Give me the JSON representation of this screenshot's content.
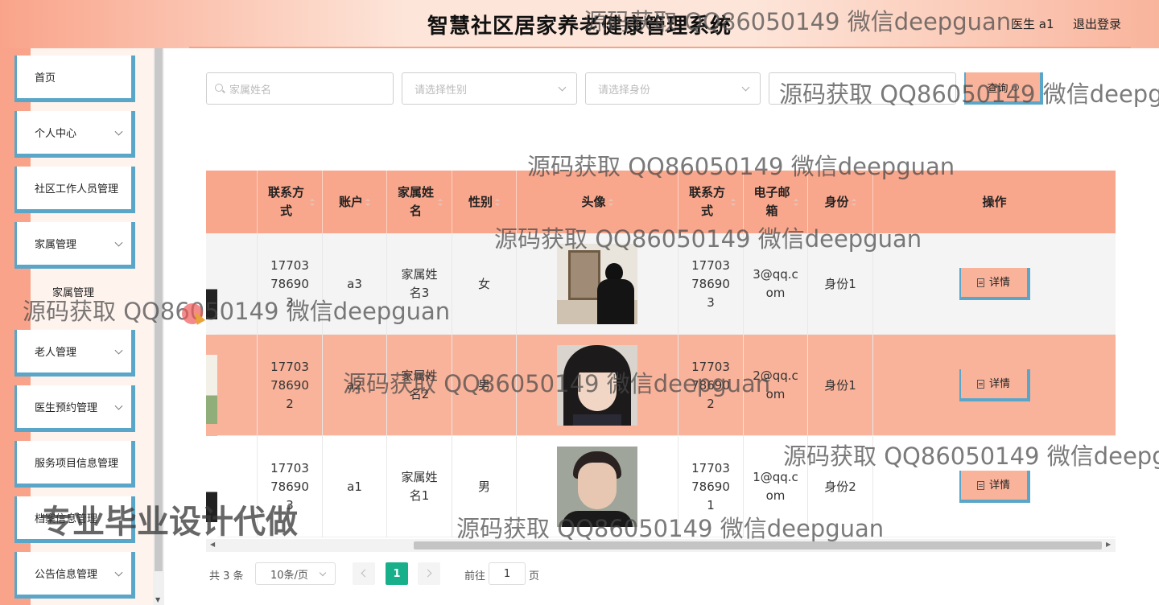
{
  "header": {
    "title": "智慧社区居家养老健康管理系统",
    "user": "医生 a1",
    "logout": "退出登录"
  },
  "sidebar": {
    "items": [
      {
        "label": "首页",
        "has_children": false
      },
      {
        "label": "个人中心",
        "has_children": true
      },
      {
        "label": "社区工作人员管理",
        "has_children": false
      },
      {
        "label": "家属管理",
        "has_children": true
      },
      {
        "label": "老人管理",
        "has_children": true
      },
      {
        "label": "医生预约管理",
        "has_children": true
      },
      {
        "label": "服务项目信息管理",
        "has_children": false
      },
      {
        "label": "档案信息管理",
        "has_children": false
      },
      {
        "label": "公告信息管理",
        "has_children": true
      }
    ],
    "sub_item": "家属管理"
  },
  "search": {
    "name_placeholder": "家属姓名",
    "gender_placeholder": "请选择性别",
    "identity_placeholder": "请选择身份",
    "query_label": "查询"
  },
  "table": {
    "columns": [
      "联系方式",
      "账户",
      "家属姓名",
      "性别",
      "头像",
      "联系方式",
      "电子邮箱",
      "身份",
      "操作"
    ],
    "rows": [
      {
        "phone": "17703786903",
        "account": "a3",
        "name": "家属姓名3",
        "gender": "女",
        "phone2": "17703786903",
        "email": "3@qq.com",
        "identity": "身份1",
        "action": "详情"
      },
      {
        "phone": "17703786902",
        "account": "a2",
        "name": "家属姓名2",
        "gender": "男",
        "phone2": "17703786902",
        "email": "2@qq.com",
        "identity": "身份1",
        "action": "详情"
      },
      {
        "phone": "17703786903",
        "account": "a1",
        "name": "家属姓名1",
        "gender": "男",
        "phone2": "17703786901",
        "email": "1@qq.com",
        "identity": "身份2",
        "action": "详情"
      }
    ]
  },
  "pagination": {
    "total": "共 3 条",
    "page_size": "10条/页",
    "current": "1",
    "goto_label": "前往",
    "goto_value": "1",
    "page_suffix": "页"
  },
  "watermarks": {
    "text": "源码获取 QQ86050149 微信deepguan",
    "clipped": "源码获取 QQ86050149 微信deepg",
    "big": "专业毕业设计代做"
  },
  "colors": {
    "accent": "#f9a78c",
    "border_blue": "#5aa6c9",
    "pager_active": "#17b08a"
  }
}
